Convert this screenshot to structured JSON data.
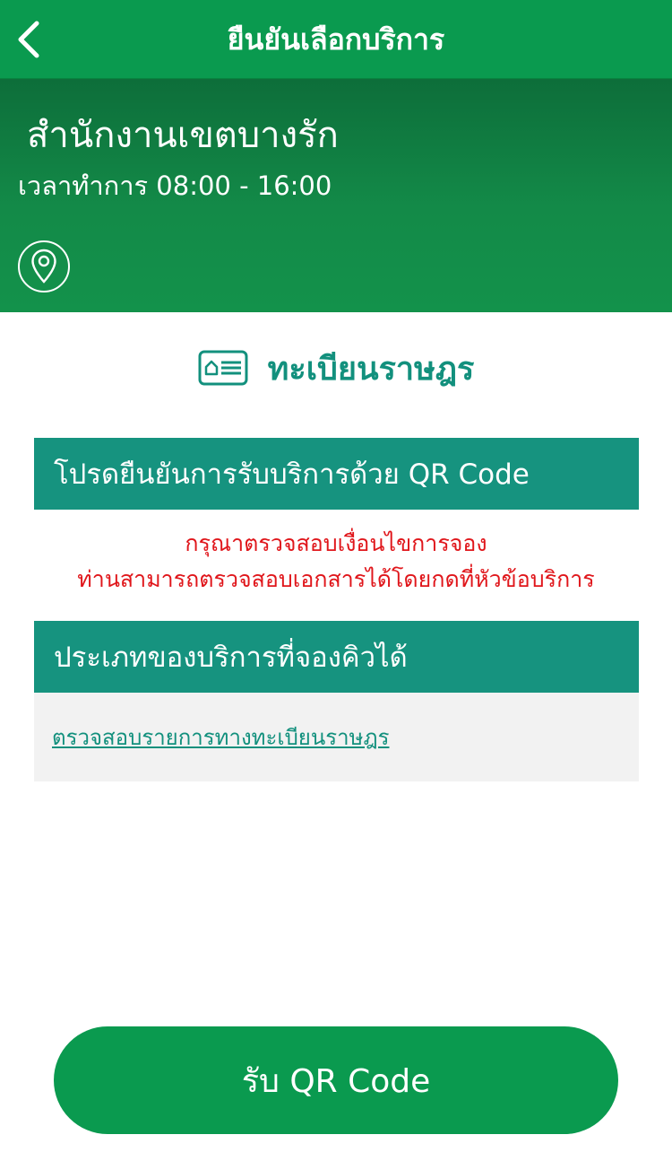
{
  "nav": {
    "title": "ยืนยันเลือกบริการ",
    "back_icon": "chevron-left-icon"
  },
  "office": {
    "name": "สำนักงานเขตบางรัก",
    "hours": "เวลาทำการ 08:00 - 16:00",
    "map_icon": "location-pin-icon"
  },
  "service": {
    "icon": "id-card-icon",
    "title": "ทะเบียนราษฎร"
  },
  "confirm_section": {
    "label": "โปรดยืนยันการรับบริการด้วย QR Code"
  },
  "warning": {
    "line1": "กรุณาตรวจสอบเงื่อนไขการจอง",
    "line2": "ท่านสามารถตรวจสอบเอกสารได้โดยกดที่หัวข้อบริการ"
  },
  "service_types_section": {
    "label": "ประเภทของบริการที่จองคิวได้",
    "items": [
      {
        "label": "ตรวจสอบรายการทางทะเบียนราษฎร"
      }
    ]
  },
  "actions": {
    "qr_button_label": "รับ QR Code"
  },
  "colors": {
    "primary_green": "#0a9a4f",
    "teal": "#16937f",
    "warning_red": "#e0161b"
  }
}
